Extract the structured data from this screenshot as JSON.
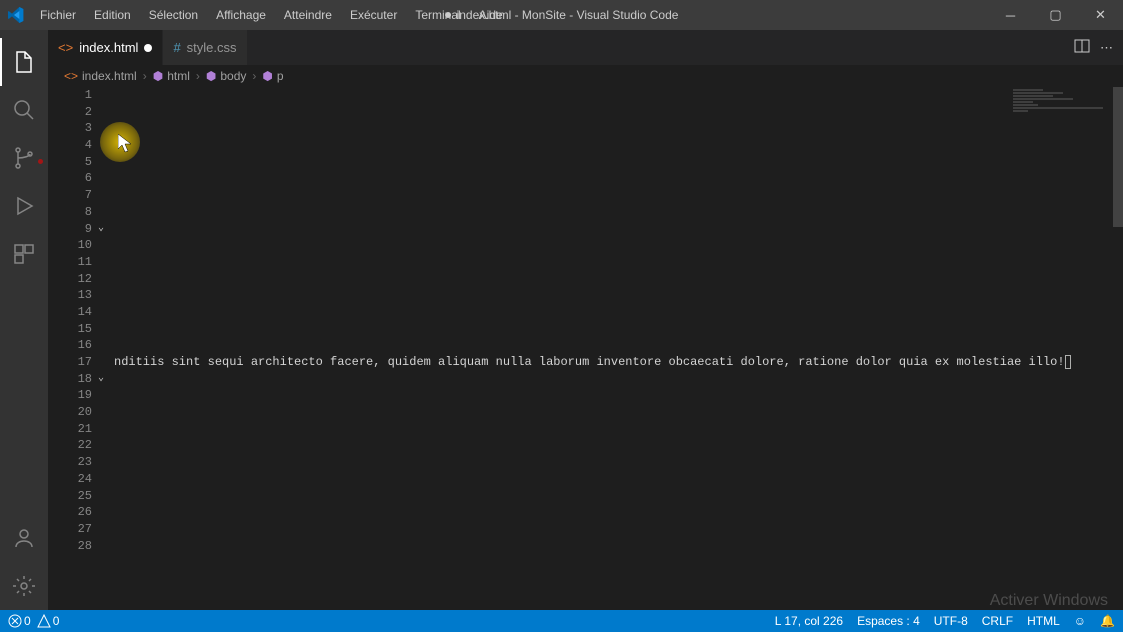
{
  "window": {
    "title_prefix": "index.html - MonSite - Visual Studio Code"
  },
  "menu": {
    "items": [
      "Fichier",
      "Edition",
      "Sélection",
      "Affichage",
      "Atteindre",
      "Exécuter",
      "Terminal",
      "Aide"
    ]
  },
  "tabs": [
    {
      "label": "index.html",
      "dirty": true,
      "active": true
    },
    {
      "label": "style.css",
      "dirty": false,
      "active": false
    }
  ],
  "breadcrumbs": {
    "items": [
      "index.html",
      "html",
      "body",
      "p"
    ]
  },
  "editor": {
    "line_start": 1,
    "line_end": 28,
    "fold_lines": [
      9,
      18
    ],
    "line17_text": "nditiis sint sequi architecto facere, quidem aliquam nulla laborum inventore obcaecati dolore, ratione dolor quia ex molestiae illo!"
  },
  "statusbar": {
    "errors": "0",
    "warnings": "0",
    "position": "L 17, col 226",
    "spaces": "Espaces : 4",
    "encoding": "UTF-8",
    "eol": "CRLF",
    "language": "HTML"
  },
  "watermark": "Activer Windows"
}
